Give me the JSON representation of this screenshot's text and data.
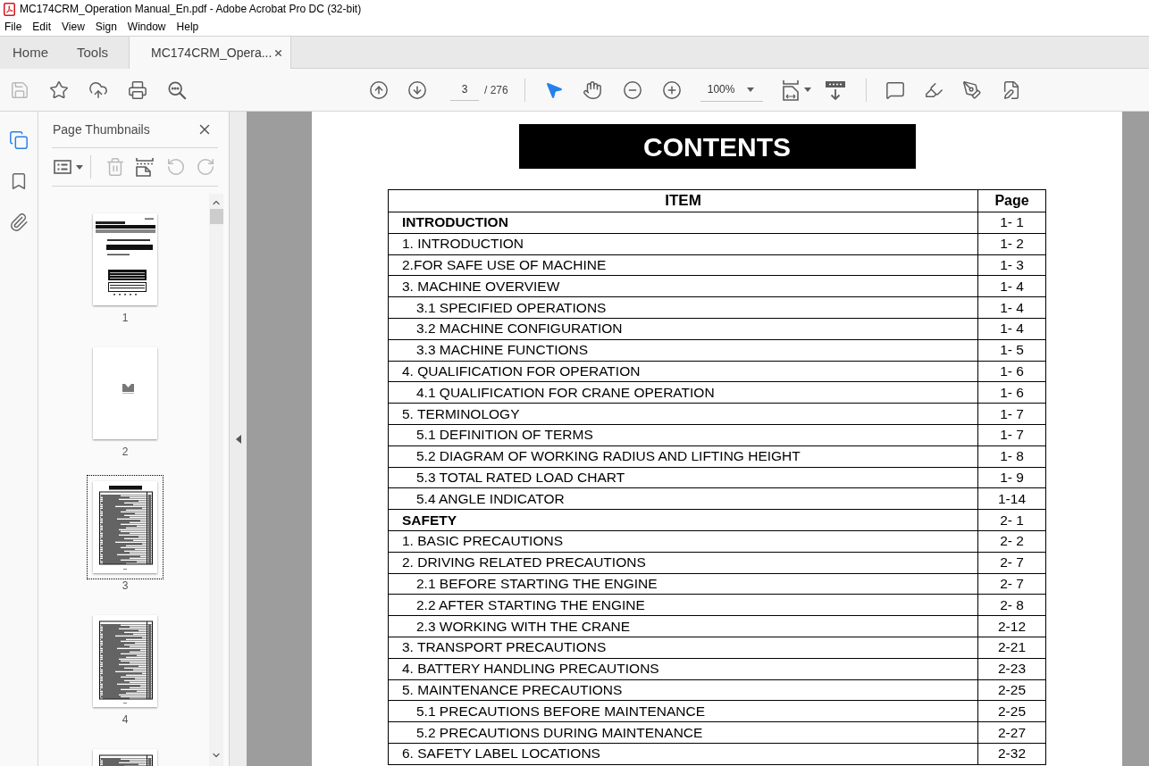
{
  "window": {
    "title": "MC174CRM_Operation Manual_En.pdf - Adobe Acrobat Pro DC (32-bit)"
  },
  "menu": [
    "File",
    "Edit",
    "View",
    "Sign",
    "Window",
    "Help"
  ],
  "tabs": [
    {
      "label": "Home",
      "selected": false,
      "closable": false
    },
    {
      "label": "Tools",
      "selected": false,
      "closable": false
    },
    {
      "label": "MC174CRM_Opera...",
      "selected": true,
      "closable": true
    }
  ],
  "toolbar": {
    "save": {
      "disabled": true
    },
    "page_field": {
      "value": "3"
    },
    "page_total": "/ 276",
    "tools": [
      {
        "kind": "select",
        "selected": true
      },
      {
        "kind": "hand",
        "selected": false
      }
    ],
    "zoom_field": {
      "value": "100%"
    }
  },
  "side_rail": [
    {
      "kind": "pages",
      "selected": true
    },
    {
      "kind": "bookmarks",
      "selected": false
    },
    {
      "kind": "attachments",
      "selected": false
    }
  ],
  "thumbnails_panel": {
    "title": "Page Thumbnails",
    "tools": [
      {
        "kind": "options",
        "disabled": false
      },
      {
        "kind": "delete",
        "disabled": true
      },
      {
        "kind": "insert",
        "disabled": false
      },
      {
        "kind": "rotate_left",
        "disabled": true
      },
      {
        "kind": "rotate_right",
        "disabled": true
      }
    ],
    "pages": [
      {
        "label": "1",
        "kind": "cover",
        "selected": false
      },
      {
        "label": "2",
        "kind": "logo",
        "selected": false
      },
      {
        "label": "3",
        "kind": "contents",
        "selected": true
      },
      {
        "label": "4",
        "kind": "list",
        "selected": false
      },
      {
        "kind": "list",
        "selected": false
      }
    ]
  },
  "document": {
    "heading": "CONTENTS",
    "columns": [
      "ITEM",
      "Page"
    ],
    "sections": [
      {
        "title": "INTRODUCTION",
        "page": "1- 1",
        "entries": [
          {
            "title": "1. INTRODUCTION",
            "page": "1- 2"
          },
          {
            "title": "2.FOR SAFE USE OF MACHINE",
            "page": "1- 3"
          },
          {
            "title": "3. MACHINE OVERVIEW",
            "page": "1- 4",
            "children": [
              {
                "title": "3.1 SPECIFIED OPERATIONS",
                "page": "1- 4"
              },
              {
                "title": "3.2 MACHINE CONFIGURATION",
                "page": "1- 4"
              },
              {
                "title": "3.3 MACHINE FUNCTIONS",
                "page": "1- 5"
              }
            ]
          },
          {
            "title": "4. QUALIFICATION FOR OPERATION",
            "page": "1- 6",
            "children": [
              {
                "title": "4.1 QUALIFICATION FOR CRANE OPERATION",
                "page": "1- 6"
              }
            ]
          },
          {
            "title": "5. TERMINOLOGY",
            "page": "1- 7",
            "children": [
              {
                "title": "5.1 DEFINITION OF TERMS",
                "page": "1- 7"
              },
              {
                "title": "5.2 DIAGRAM OF WORKING RADIUS AND LIFTING HEIGHT",
                "page": "1- 8"
              },
              {
                "title": "5.3 TOTAL RATED LOAD CHART",
                "page": "1- 9"
              },
              {
                "title": "5.4 ANGLE INDICATOR",
                "page": "1-14"
              }
            ]
          }
        ]
      },
      {
        "title": "SAFETY",
        "page": "2- 1",
        "entries": [
          {
            "title": "1. BASIC PRECAUTIONS",
            "page": "2- 2"
          },
          {
            "title": "2. DRIVING RELATED PRECAUTIONS",
            "page": "2- 7",
            "children": [
              {
                "title": "2.1 BEFORE STARTING THE ENGINE",
                "page": "2- 7"
              },
              {
                "title": "2.2 AFTER STARTING THE ENGINE",
                "page": "2- 8"
              },
              {
                "title": "2.3 WORKING WITH THE CRANE",
                "page": "2-12"
              }
            ]
          },
          {
            "title": "3. TRANSPORT PRECAUTIONS",
            "page": "2-21"
          },
          {
            "title": "4. BATTERY HANDLING PRECAUTIONS",
            "page": "2-23"
          },
          {
            "title": "5. MAINTENANCE PRECAUTIONS",
            "page": "2-25",
            "children": [
              {
                "title": "5.1 PRECAUTIONS BEFORE MAINTENANCE",
                "page": "2-25"
              },
              {
                "title": "5.2 PRECAUTIONS DURING MAINTENANCE",
                "page": "2-27"
              }
            ]
          },
          {
            "title": "6. SAFETY LABEL LOCATIONS",
            "page": "2-32"
          }
        ]
      }
    ]
  }
}
